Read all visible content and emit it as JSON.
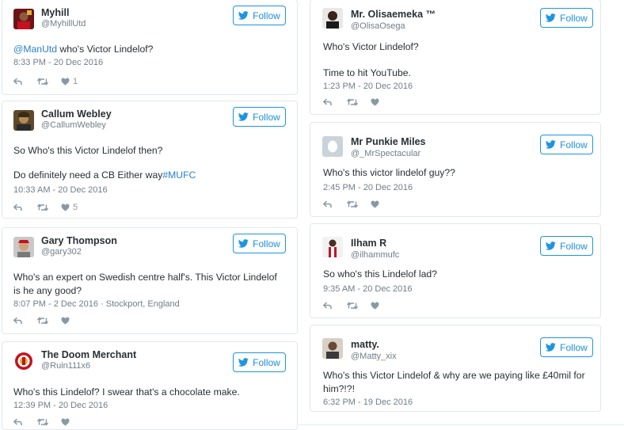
{
  "follow_label": "Follow",
  "left_tweets": [
    {
      "name": "Myhill",
      "handle": "@MyhillUtd",
      "text_mention": "@ManUtd",
      "text_rest": " who's Victor Lindelof?",
      "timestamp": "8:33 PM - 20 Dec 2016",
      "likes": "1"
    },
    {
      "name": "Callum Webley",
      "handle": "@CallumWebley",
      "text_line1": "So Who's this Victor Lindelof then?",
      "text_line2_plain": "Do definitely need a CB Either way",
      "text_line2_hashtag": "#MUFC",
      "timestamp": "10:33 AM - 20 Dec 2016",
      "likes": "5"
    },
    {
      "name": "Gary Thompson",
      "handle": "@gary302",
      "text": "Who's an expert on Swedish centre half's. This Victor Lindelof is he any good?",
      "timestamp": "8:07 PM - 2 Dec 2016",
      "location": " · Stockport, England"
    },
    {
      "name": "The Doom Merchant",
      "handle": "@Ruin111x6",
      "text": "Who's this Lindelof? I swear that's a chocolate make.",
      "timestamp": "12:39 PM - 20 Dec 2016"
    }
  ],
  "right_tweets": [
    {
      "name": "Mr. Olisaemeka ™",
      "handle": "@OlisaOsega",
      "text_line1": "Who's Victor Lindelof?",
      "text_line2": "Time to hit YouTube.",
      "timestamp": "1:23 PM - 20 Dec 2016"
    },
    {
      "name": "Mr Punkie Miles",
      "handle": "@_MrSpectacular",
      "text": "Who's this victor lindelof guy??",
      "timestamp": "2:45 PM - 20 Dec 2016"
    },
    {
      "name": "Ilham R",
      "handle": "@ilhammufc",
      "text": "So who's this Lindelof lad?",
      "timestamp": "9:35 AM - 20 Dec 2016"
    },
    {
      "name": "matty.",
      "handle": "@Matty_xix",
      "text": "Who's this Victor Lindelof & why are we paying like £40mil for him?!?!",
      "timestamp": "6:32 PM - 19 Dec 2016"
    }
  ],
  "colors": {
    "accent": "#1d95e0",
    "link": "#2a81c6",
    "muted": "#707e88",
    "icon": "#8899a6",
    "border": "#e1e8ed"
  }
}
